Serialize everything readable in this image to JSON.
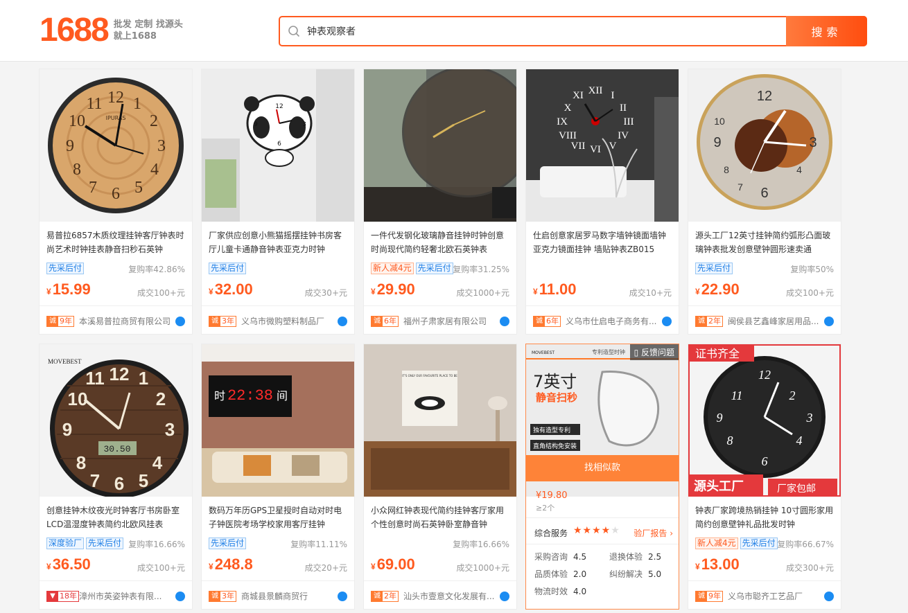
{
  "header": {
    "logo": "1688",
    "slogan_line1": "批发 定制 找源头",
    "slogan_line2": "就上1688",
    "search_value": "钟表观察者",
    "search_button": "搜索"
  },
  "products": [
    {
      "title": "易普拉6857木质纹理挂钟客厅钟表时尚艺术时钟挂表静音扫秒石英钟",
      "tags": [
        "先采后付"
      ],
      "repurchase": "复购率42.86%",
      "price": "15.99",
      "deal": "成交100+元",
      "years": "9年",
      "company": "本溪易普拉商贸有限公司"
    },
    {
      "title": "厂家供应创意小熊猫摇摆挂钟书房客厅儿童卡通静音钟表亚克力时钟",
      "tags": [
        "先采后付"
      ],
      "repurchase": "",
      "price": "32.00",
      "deal": "成交30+元",
      "years": "3年",
      "company": "义乌市微购塑料制品厂"
    },
    {
      "title": "一件代发钢化玻璃静音挂钟时钟创意时尚现代简约轻奢北欧石英钟表",
      "tags": [
        "新人减4元",
        "先采后付"
      ],
      "repurchase": "复购率31.25%",
      "price": "29.90",
      "deal": "成交1000+元",
      "years": "6年",
      "company": "福州子肃家居有限公司"
    },
    {
      "title": "仕启创意家居罗马数字墙钟镜面墙钟亚克力镜面挂钟 墙贴钟表ZB015",
      "tags": [],
      "repurchase": "",
      "price": "11.00",
      "deal": "成交10+元",
      "years": "6年",
      "company": "义乌市仕启电子商务有..."
    },
    {
      "title": "源头工厂12英寸挂钟简约弧形凸面玻璃钟表批发创意壁钟圆形速卖通",
      "tags": [
        "先采后付"
      ],
      "repurchase": "复购率50%",
      "price": "22.90",
      "deal": "成交100+元",
      "years": "2年",
      "company": "闽侯县艺鑫峰家居用品..."
    },
    {
      "title": "创意挂钟木纹夜光时钟客厅书房卧室LCD温湿度钟表简约北欧风挂表",
      "tags": [
        "深度验厂",
        "先采后付"
      ],
      "repurchase": "复购率16.66%",
      "price": "36.50",
      "deal": "成交100+元",
      "years": "18年",
      "company": "漳州市英姿钟表有限...",
      "badge": "red"
    },
    {
      "title": "数码万年历GPS卫星授时自动对时电子钟医院考场学校家用客厅挂钟",
      "tags": [
        "先采后付"
      ],
      "repurchase": "复购率11.11%",
      "price": "248.8",
      "deal": "成交20+元",
      "years": "3年",
      "company": "商城县景麟商贸行"
    },
    {
      "title": "小众网红钟表现代简约挂钟客厅家用个性创意时尚石英钟卧室静音钟",
      "tags": [],
      "repurchase": "复购率16.66%",
      "price": "69.00",
      "deal": "成交1000+元",
      "years": "2年",
      "company": "汕头市壹意文化发展有..."
    },
    {
      "title": "钟表厂家跨境热销挂钟 10寸圆形家用简约创意壁钟礼品批发时钟",
      "tags": [
        "新人减4元",
        "先采后付"
      ],
      "repurchase": "复购率66.67%",
      "price": "13.00",
      "deal": "成交300+元",
      "years": "9年",
      "company": "义乌市聪齐工艺品厂"
    }
  ],
  "hover_card": {
    "brand": "MOVEBEST",
    "banner": "专利造型时钟",
    "headline1": "7英寸",
    "headline2": "静音扫秒",
    "feature1": "独有造型专利",
    "feature2": "直角结构免安装",
    "feedback": "反馈问题",
    "similar": "找相似款",
    "price": "¥19.80",
    "min_order": "≥2个",
    "service_label": "综合服务",
    "stars": 4,
    "report": "验厂报告",
    "metrics": [
      {
        "label": "采购咨询",
        "value": "4.5"
      },
      {
        "label": "退换体验",
        "value": "2.5"
      },
      {
        "label": "品质体验",
        "value": "2.0"
      },
      {
        "label": "纠纷解决",
        "value": "5.0"
      },
      {
        "label": "物流时效",
        "value": "4.0"
      }
    ]
  },
  "overlays": {
    "cert": "证书齐全",
    "factory": "源头工厂",
    "shipping": "厂家包邮",
    "clock_brand": "IPURAS",
    "led_time": "22:38",
    "led_left": "时",
    "led_right": "间",
    "movebest": "MOVEBEST",
    "lcd": "30.50",
    "poster": "IT'S ONLY OUR FAVOURITE PLACE TO BE"
  }
}
